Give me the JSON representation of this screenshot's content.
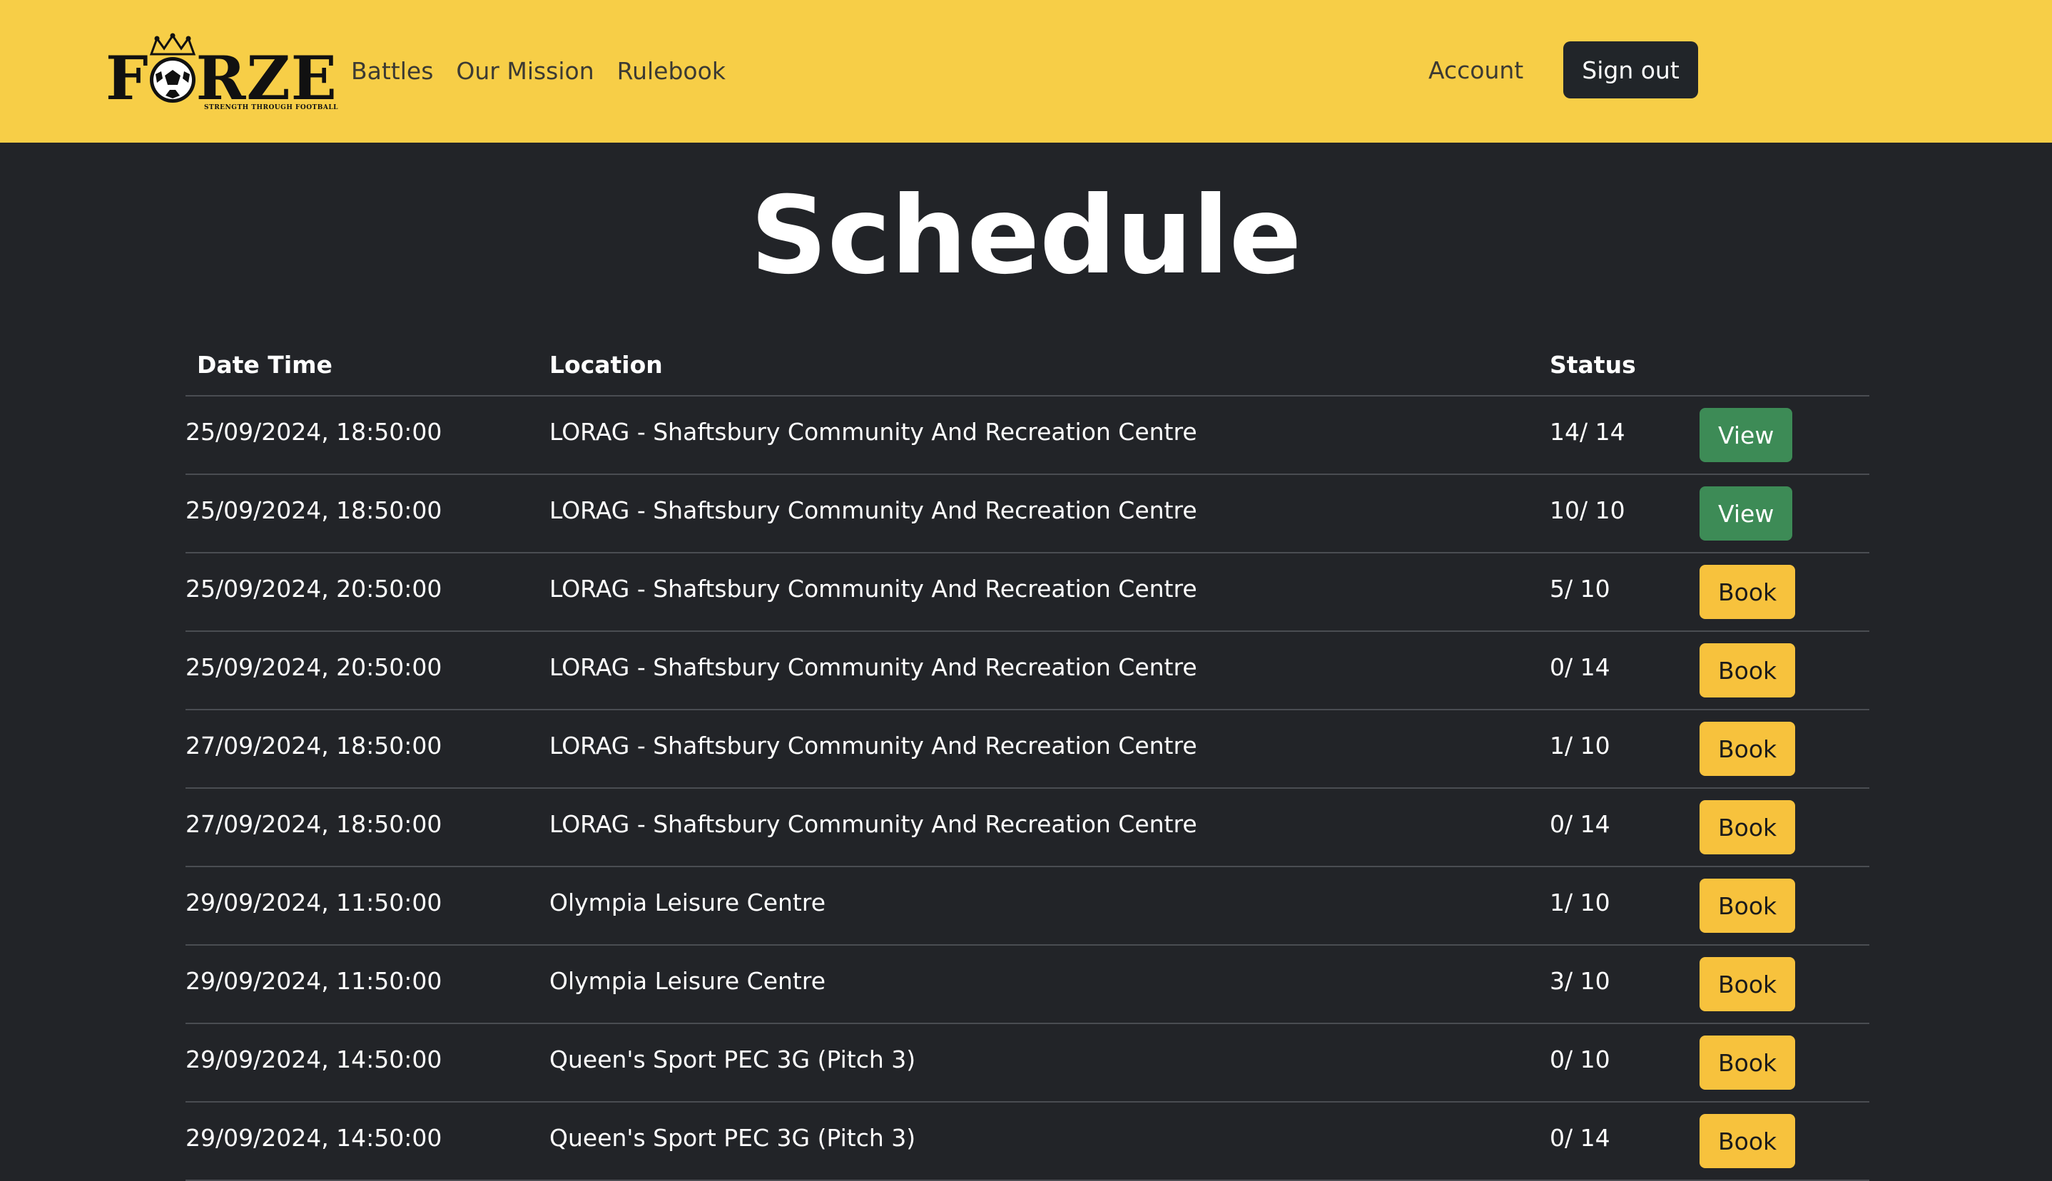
{
  "brand": {
    "logo_text": "FORZE",
    "logo_before": "F",
    "logo_after": "RZE",
    "tagline": "STRENGTH THROUGH FOOTBALL"
  },
  "nav": {
    "links": [
      "Battles",
      "Our Mission",
      "Rulebook"
    ],
    "account": "Account",
    "sign_out": "Sign out"
  },
  "page": {
    "title": "Schedule"
  },
  "table": {
    "headers": {
      "date_time": "Date Time",
      "location": "Location",
      "status": "Status"
    },
    "rows": [
      {
        "date": "25/09/2024, 18:50:00",
        "location": "LORAG - Shaftsbury Community And Recreation Centre",
        "status": "14/ 14",
        "action": "View"
      },
      {
        "date": "25/09/2024, 18:50:00",
        "location": "LORAG - Shaftsbury Community And Recreation Centre",
        "status": "10/ 10",
        "action": "View"
      },
      {
        "date": "25/09/2024, 20:50:00",
        "location": "LORAG - Shaftsbury Community And Recreation Centre",
        "status": "5/ 10",
        "action": "Book"
      },
      {
        "date": "25/09/2024, 20:50:00",
        "location": "LORAG - Shaftsbury Community And Recreation Centre",
        "status": "0/ 14",
        "action": "Book"
      },
      {
        "date": "27/09/2024, 18:50:00",
        "location": "LORAG - Shaftsbury Community And Recreation Centre",
        "status": "1/ 10",
        "action": "Book"
      },
      {
        "date": "27/09/2024, 18:50:00",
        "location": "LORAG - Shaftsbury Community And Recreation Centre",
        "status": "0/ 14",
        "action": "Book"
      },
      {
        "date": "29/09/2024, 11:50:00",
        "location": "Olympia Leisure Centre",
        "status": "1/ 10",
        "action": "Book"
      },
      {
        "date": "29/09/2024, 11:50:00",
        "location": "Olympia Leisure Centre",
        "status": "3/ 10",
        "action": "Book"
      },
      {
        "date": "29/09/2024, 14:50:00",
        "location": "Queen's Sport PEC 3G (Pitch 3)",
        "status": "0/ 10",
        "action": "Book"
      },
      {
        "date": "29/09/2024, 14:50:00",
        "location": "Queen's Sport PEC 3G (Pitch 3)",
        "status": "0/ 14",
        "action": "Book"
      }
    ]
  },
  "colors": {
    "navbar_bg": "#f7ce47",
    "page_bg": "#222428",
    "view_button": "#3d8b56",
    "book_button": "#f7c23d",
    "signout_button": "#212529"
  },
  "icons": {
    "logo_mark": "football-crown-icon"
  }
}
